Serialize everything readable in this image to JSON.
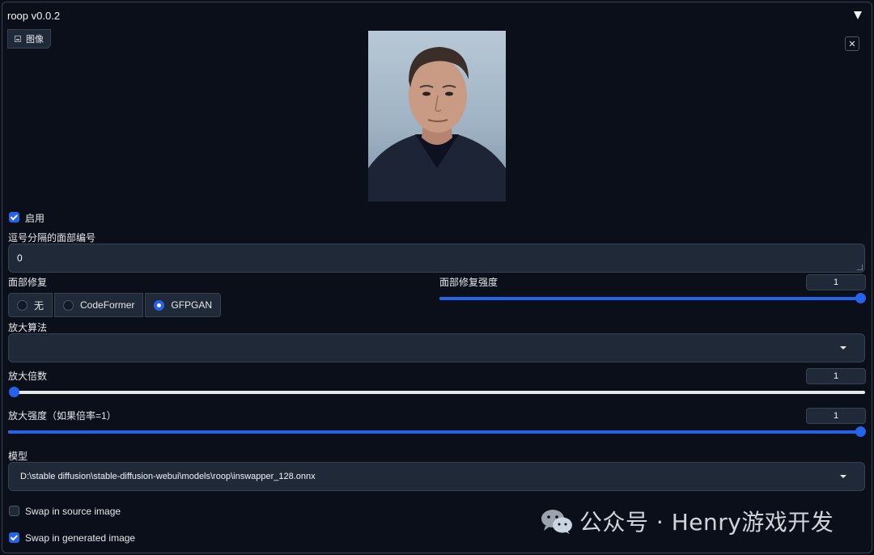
{
  "panel": {
    "title": "roop v0.0.2",
    "image_tab_label": "图像"
  },
  "enable": {
    "label": "启用",
    "checked": true
  },
  "face_index": {
    "label": "逗号分隔的面部编号",
    "value": "0"
  },
  "face_restore": {
    "label": "面部修复",
    "options": [
      "无",
      "CodeFormer",
      "GFPGAN"
    ],
    "selected": "GFPGAN",
    "strength_label": "面部修复强度",
    "strength_value": "1",
    "strength_fraction": 1.0
  },
  "upscaler": {
    "label": "放大算法",
    "value": ""
  },
  "upscale_factor": {
    "label": "放大倍数",
    "value": "1",
    "fraction": 0.0
  },
  "upscale_strength": {
    "label": "放大强度（如果倍率=1）",
    "value": "1",
    "fraction": 1.0
  },
  "model": {
    "label": "模型",
    "value": "D:\\stable diffusion\\stable-diffusion-webui\\models\\roop\\inswapper_128.onnx"
  },
  "swap_source": {
    "label": "Swap in source image",
    "checked": false
  },
  "swap_generated": {
    "label": "Swap in generated image",
    "checked": true
  },
  "watermark": {
    "text": "公众号 · Henry游戏开发"
  },
  "colors": {
    "accent": "#2563eb",
    "background": "#0b0f19",
    "input_bg": "#1f2937",
    "border": "#374151"
  }
}
